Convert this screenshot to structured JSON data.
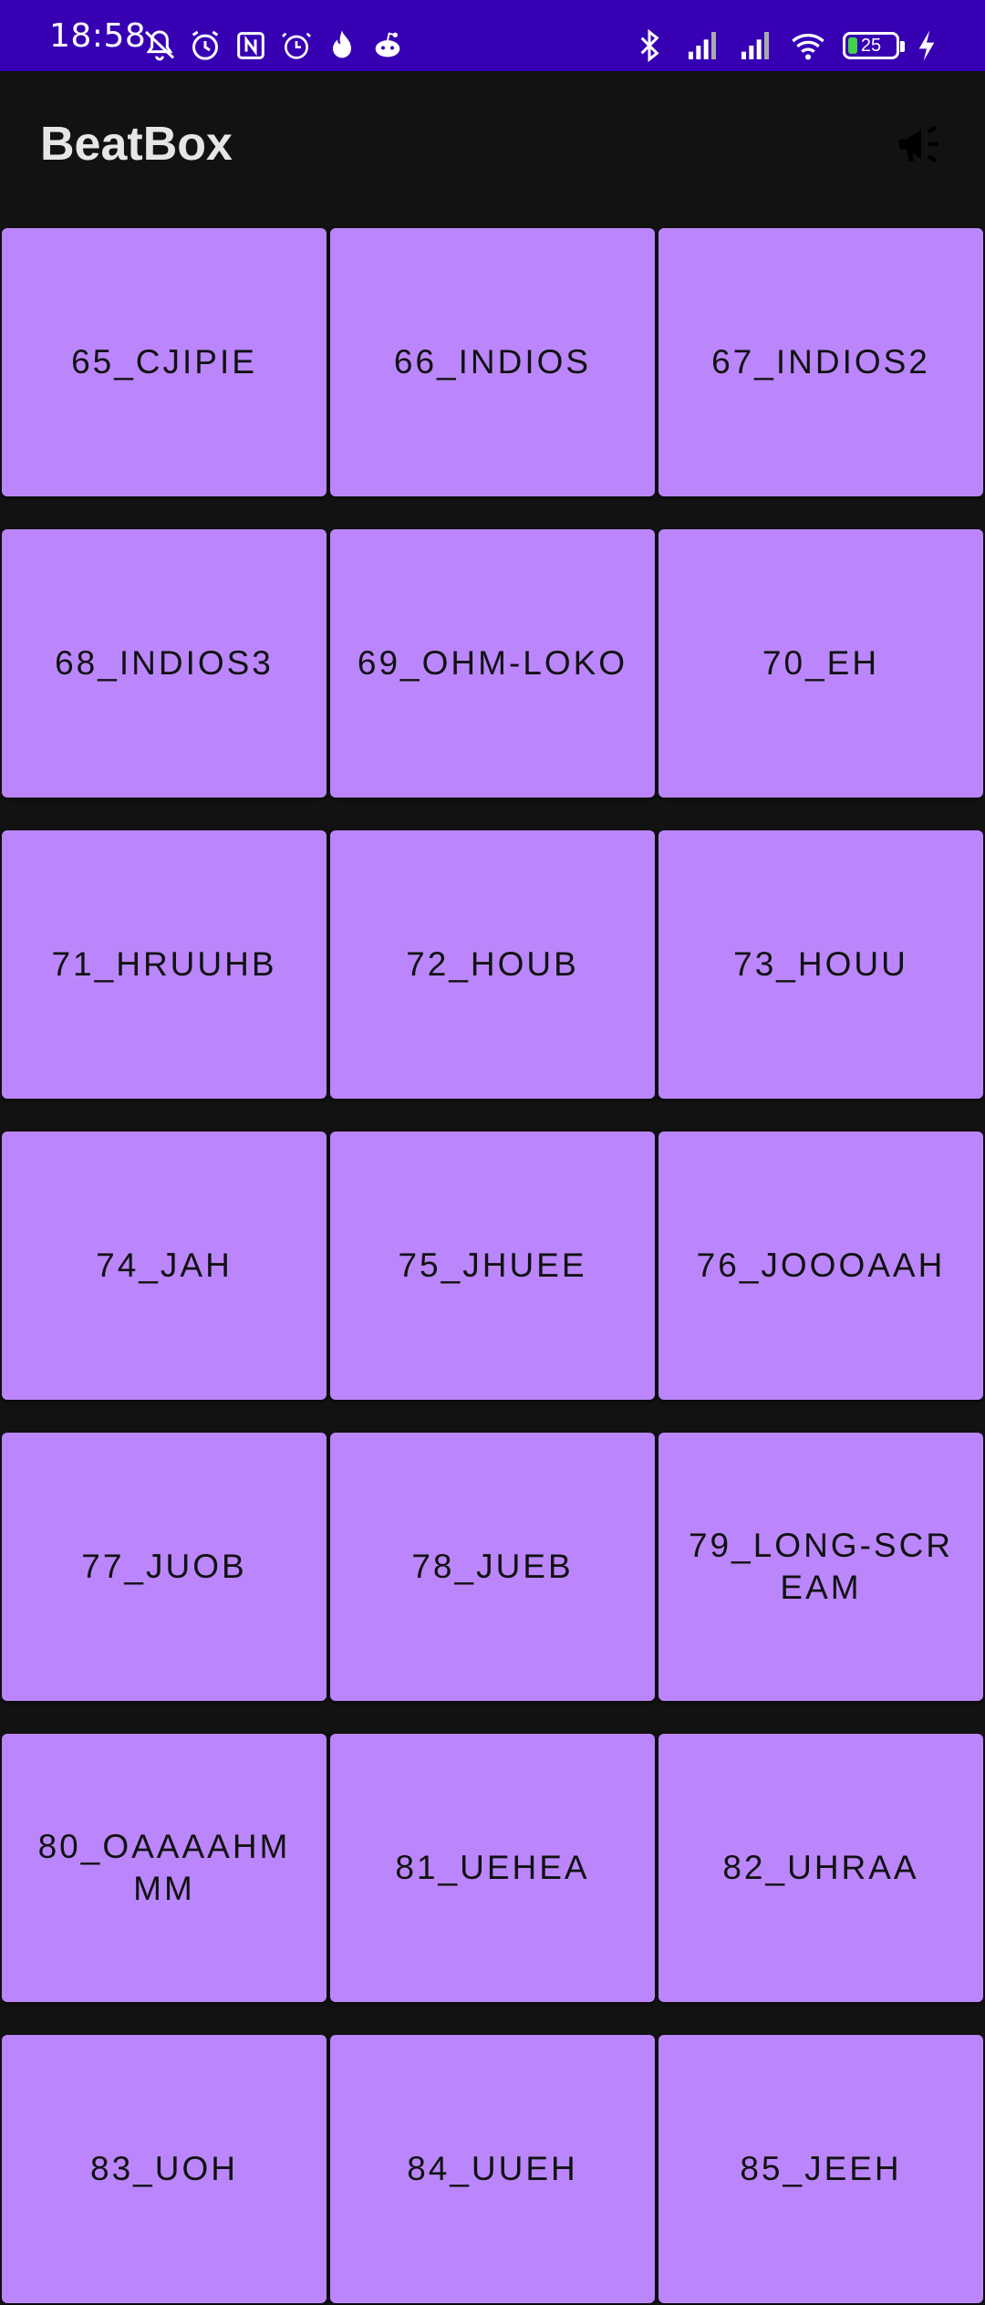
{
  "status_bar": {
    "time": "18:58",
    "battery_level": "25",
    "left_icons": [
      "mute-icon",
      "alarm-clock-icon",
      "nfc-icon",
      "alarm-icon",
      "flame-icon",
      "reddit-icon"
    ],
    "right_icons": [
      "bluetooth-icon",
      "signal-icon",
      "signal-icon",
      "wifi-icon",
      "battery-icon",
      "charging-icon"
    ]
  },
  "app_bar": {
    "title": "BeatBox",
    "action_icon": "megaphone-icon"
  },
  "sounds": [
    "65_CJIPIE",
    "66_INDIOS",
    "67_INDIOS2",
    "68_INDIOS3",
    "69_OHM-LOKO",
    "70_EH",
    "71_HRUUHB",
    "72_HOUB",
    "73_HOUU",
    "74_JAH",
    "75_JHUEE",
    "76_JOOOAAH",
    "77_JUOB",
    "78_JUEB",
    "79_LONG-SCREAM",
    "80_OAAAAHMMM",
    "81_UEHEA",
    "82_UHRAA",
    "83_UOH",
    "84_UUEH",
    "85_JEEH"
  ],
  "colors": {
    "status_bar": "#3700B3",
    "background": "#121212",
    "tile": "#BB86FC"
  }
}
